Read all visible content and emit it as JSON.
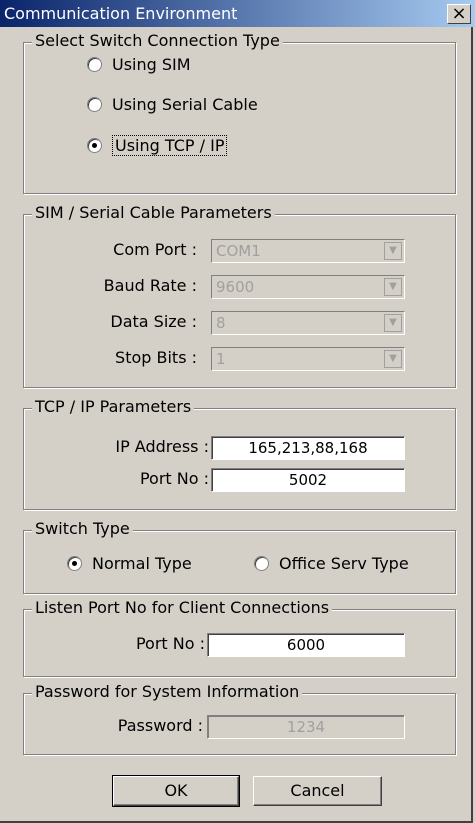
{
  "window": {
    "title": "Communication Environment",
    "close_glyph": "×"
  },
  "connection": {
    "legend": "Select Switch Connection Type",
    "options": [
      {
        "label": "Using SIM",
        "selected": false
      },
      {
        "label": "Using Serial Cable",
        "selected": false
      },
      {
        "label": "Using TCP / IP",
        "selected": true
      }
    ]
  },
  "serial": {
    "legend": "SIM / Serial Cable Parameters",
    "com_port_label": "Com Port :",
    "com_port_value": "COM1",
    "baud_label": "Baud Rate :",
    "baud_value": "9600",
    "data_size_label": "Data Size :",
    "data_size_value": "8",
    "stop_bits_label": "Stop Bits :",
    "stop_bits_value": "1"
  },
  "tcp": {
    "legend": "TCP / IP Parameters",
    "ip_label": "IP Address :",
    "ip_value": "165,213,88,168",
    "port_label": "Port No :",
    "port_value": "5002"
  },
  "switch_type": {
    "legend": "Switch Type",
    "options": [
      {
        "label": "Normal Type",
        "selected": true
      },
      {
        "label": "Office Serv Type",
        "selected": false
      }
    ]
  },
  "listen": {
    "legend": "Listen Port No for Client Connections",
    "port_label": "Port No :",
    "port_value": "6000"
  },
  "password": {
    "legend": "Password for System Information",
    "label": "Password :",
    "value": "1234"
  },
  "buttons": {
    "ok": "OK",
    "cancel": "Cancel"
  }
}
